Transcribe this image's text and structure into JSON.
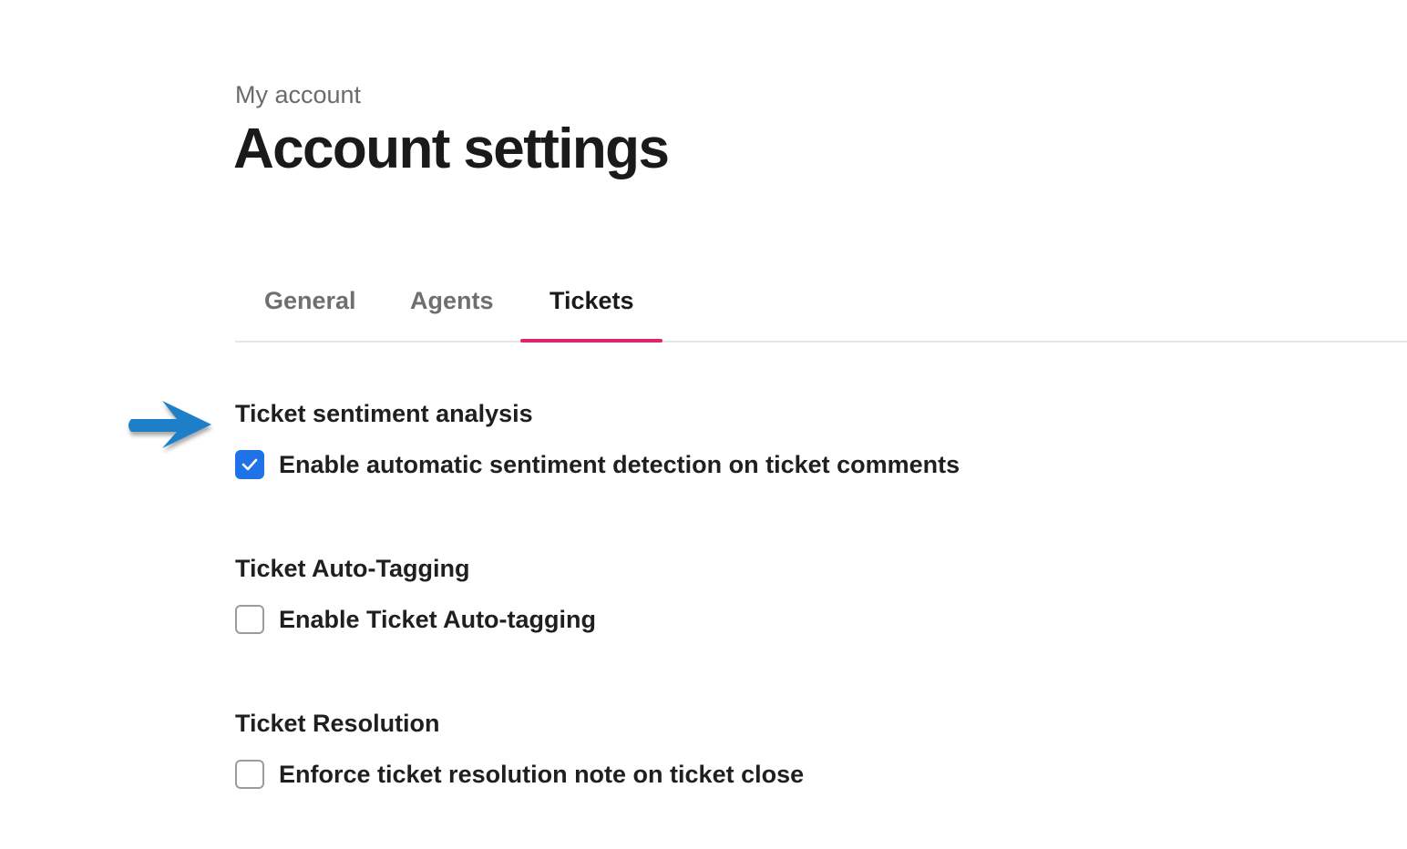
{
  "header": {
    "breadcrumb": "My account",
    "title": "Account settings"
  },
  "tabs": [
    {
      "label": "General",
      "active": false
    },
    {
      "label": "Agents",
      "active": false
    },
    {
      "label": "Tickets",
      "active": true
    }
  ],
  "sections": [
    {
      "title": "Ticket sentiment analysis",
      "option_label": "Enable automatic sentiment detection on ticket comments",
      "checked": true
    },
    {
      "title": "Ticket Auto-Tagging",
      "option_label": "Enable Ticket Auto-tagging",
      "checked": false
    },
    {
      "title": "Ticket Resolution",
      "option_label": "Enforce ticket resolution note on ticket close",
      "checked": false
    }
  ],
  "colors": {
    "accent_tab": "#e0256f",
    "checkbox_checked": "#1f73e6",
    "arrow": "#1a7fc7"
  },
  "icons": {
    "annotation": "arrow-right-icon",
    "check": "checkmark-icon"
  }
}
